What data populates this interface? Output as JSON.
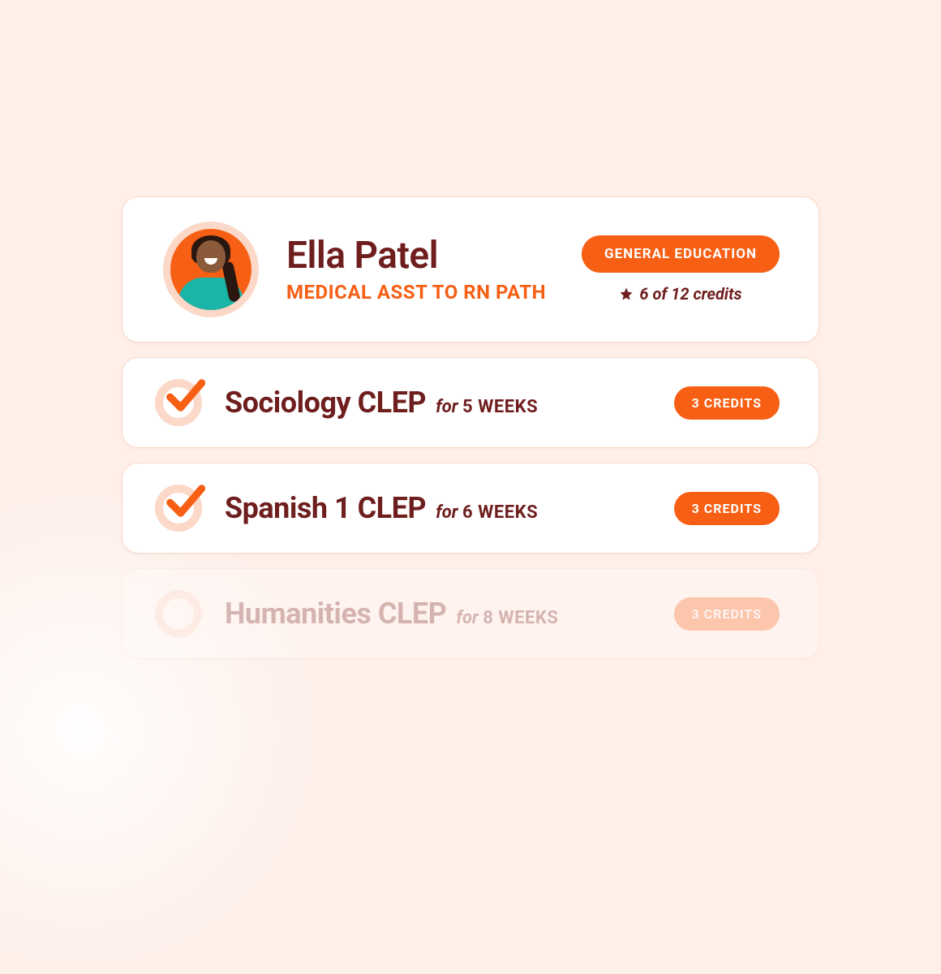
{
  "header": {
    "student_name": "Ella Patel",
    "path_label": "MEDICAL ASST TO RN PATH",
    "category_pill": "GENERAL EDUCATION",
    "credits_text": "6 of 12 credits"
  },
  "courses": [
    {
      "title": "Sociology CLEP",
      "for_label": "for",
      "duration": "5 WEEKS",
      "credits_label": "3 CREDITS",
      "completed": true,
      "faded": false
    },
    {
      "title": "Spanish 1 CLEP",
      "for_label": "for",
      "duration": "6 WEEKS",
      "credits_label": "3 CREDITS",
      "completed": true,
      "faded": false
    },
    {
      "title": "Humanities CLEP",
      "for_label": "for",
      "duration": "8 WEEKS",
      "credits_label": "3 CREDITS",
      "completed": false,
      "faded": true
    }
  ]
}
